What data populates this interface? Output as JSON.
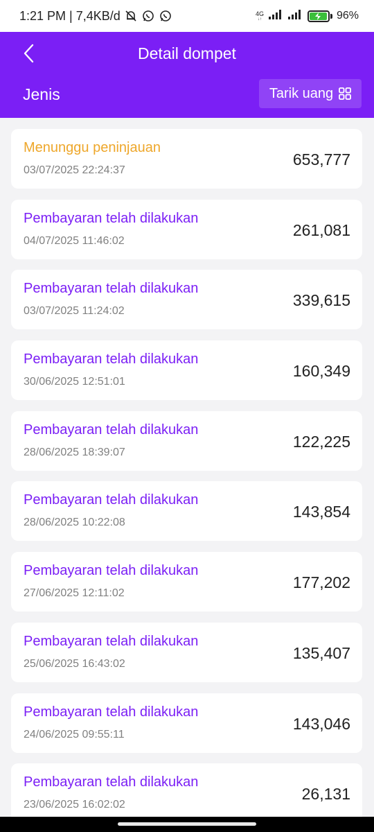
{
  "status_bar": {
    "time_net": "1:21 PM | 7,4KB/d",
    "network": "4G",
    "battery": "96%"
  },
  "header": {
    "title": "Detail dompet",
    "filter_label": "Jenis",
    "withdraw_label": "Tarik uang"
  },
  "transactions": [
    {
      "status": "Menunggu peninjauan",
      "date": "03/07/2025 22:24:37",
      "amount": "653,777"
    },
    {
      "status": "Pembayaran telah dilakukan",
      "date": "04/07/2025 11:46:02",
      "amount": "261,081"
    },
    {
      "status": "Pembayaran telah dilakukan",
      "date": "03/07/2025 11:24:02",
      "amount": "339,615"
    },
    {
      "status": "Pembayaran telah dilakukan",
      "date": "30/06/2025 12:51:01",
      "amount": "160,349"
    },
    {
      "status": "Pembayaran telah dilakukan",
      "date": "28/06/2025 18:39:07",
      "amount": "122,225"
    },
    {
      "status": "Pembayaran telah dilakukan",
      "date": "28/06/2025 10:22:08",
      "amount": "143,854"
    },
    {
      "status": "Pembayaran telah dilakukan",
      "date": "27/06/2025 12:11:02",
      "amount": "177,202"
    },
    {
      "status": "Pembayaran telah dilakukan",
      "date": "25/06/2025 16:43:02",
      "amount": "135,407"
    },
    {
      "status": "Pembayaran telah dilakukan",
      "date": "24/06/2025 09:55:11",
      "amount": "143,046"
    },
    {
      "status": "Pembayaran telah dilakukan",
      "date": "23/06/2025 16:02:02",
      "amount": "26,131"
    }
  ],
  "colors": {
    "brand": "#7b1ff5",
    "pending": "#eea72b",
    "background": "#f3f3f5"
  }
}
